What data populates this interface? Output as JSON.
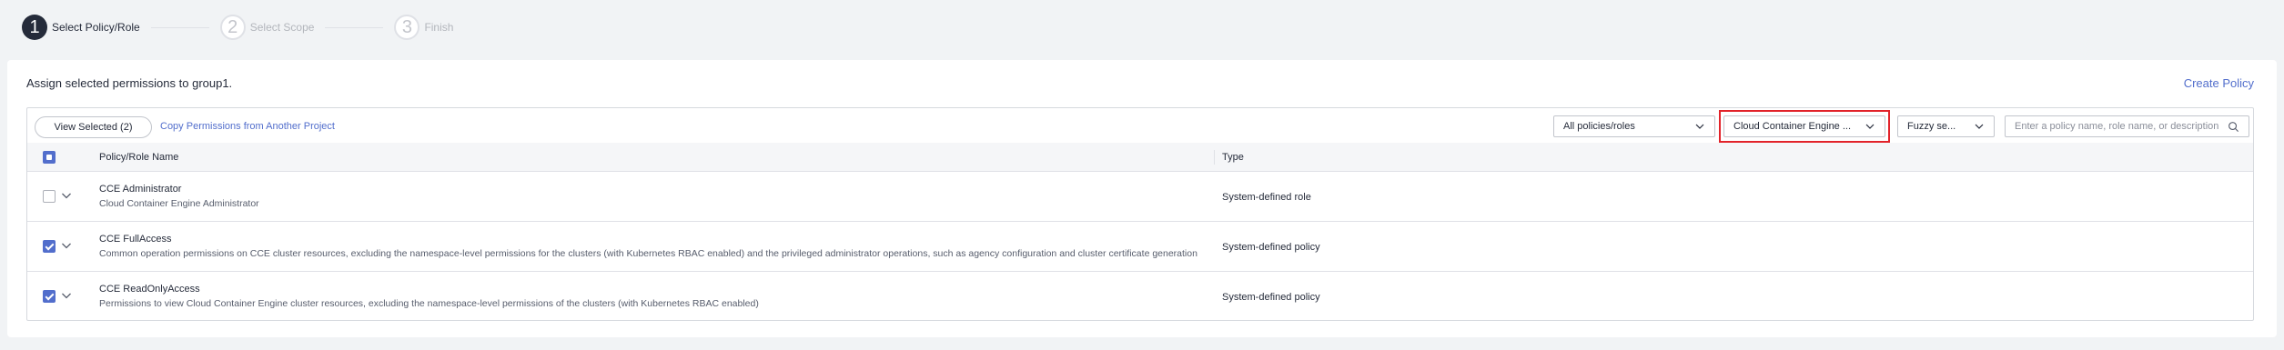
{
  "steps": [
    {
      "num": "1",
      "label": "Select Policy/Role"
    },
    {
      "num": "2",
      "label": "Select Scope"
    },
    {
      "num": "3",
      "label": "Finish"
    }
  ],
  "header": {
    "title": "Assign selected permissions to group1.",
    "create_link": "Create Policy"
  },
  "toolbar": {
    "view_selected": "View Selected (2)",
    "copy_link": "Copy Permissions from Another Project",
    "filter_all": "All policies/roles",
    "filter_service": "Cloud Container Engine ...",
    "filter_fuzzy": "Fuzzy se...",
    "search_placeholder": "Enter a policy name, role name, or description"
  },
  "table": {
    "columns": [
      "Policy/Role Name",
      "Type"
    ],
    "rows": [
      {
        "name": "CCE Administrator",
        "desc": "Cloud Container Engine Administrator",
        "type": "System-defined role",
        "checked": false
      },
      {
        "name": "CCE FullAccess",
        "desc": "Common operation permissions on CCE cluster resources, excluding the namespace-level permissions for the clusters (with Kubernetes RBAC enabled) and the privileged administrator operations, such as agency configuration and cluster certificate generation",
        "type": "System-defined policy",
        "checked": true
      },
      {
        "name": "CCE ReadOnlyAccess",
        "desc": "Permissions to view Cloud Container Engine cluster resources, excluding the namespace-level permissions of the clusters (with Kubernetes RBAC enabled)",
        "type": "System-defined policy",
        "checked": true
      }
    ]
  },
  "colors": {
    "accent": "#526ecc",
    "highlight": "#e2232a"
  }
}
